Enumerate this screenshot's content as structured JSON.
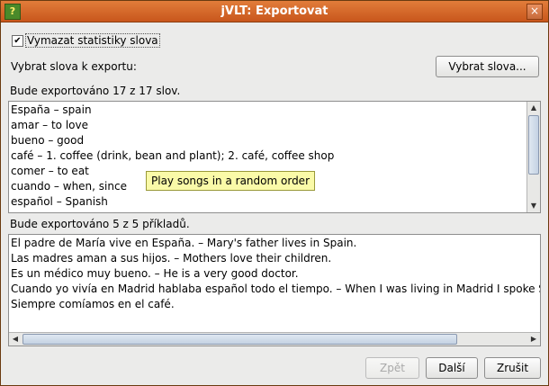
{
  "window": {
    "title": "jVLT: Exportovat",
    "app_icon_glyph": "?",
    "close_glyph": "×"
  },
  "clear_stats": {
    "checked": true,
    "check_glyph": "✔",
    "label": "Vymazat statistiky slova"
  },
  "select_words": {
    "label": "Vybrat slova k exportu:",
    "button_label": "Vybrat slova..."
  },
  "words": {
    "summary": "Bude exportováno 17 z 17 slov.",
    "items": [
      "España – spain",
      "amar – to love",
      "bueno – good",
      "café – 1. coffee (drink, bean and plant); 2. café, coffee shop",
      "comer – to eat",
      "cuando – when, since",
      "español – Spanish"
    ]
  },
  "tooltip": {
    "text": "Play songs in a random order"
  },
  "examples": {
    "summary": "Bude exportováno 5 z 5 příkladů.",
    "items": [
      "El padre de María vive en España. – Mary's father lives in Spain.",
      "Las madres aman a sus hijos. – Mothers love their children.",
      "Es un médico muy bueno. – He is a very good doctor.",
      "Cuando yo vivía en Madrid hablaba español todo el tiempo. – When I was living in Madrid I spoke Spa",
      "Siempre comíamos en el café."
    ]
  },
  "footer": {
    "back_label": "Zpět",
    "back_enabled": false,
    "next_label": "Další",
    "cancel_label": "Zrušit"
  },
  "scroll_arrows": {
    "up": "▲",
    "down": "▼",
    "left": "◀",
    "right": "▶"
  }
}
